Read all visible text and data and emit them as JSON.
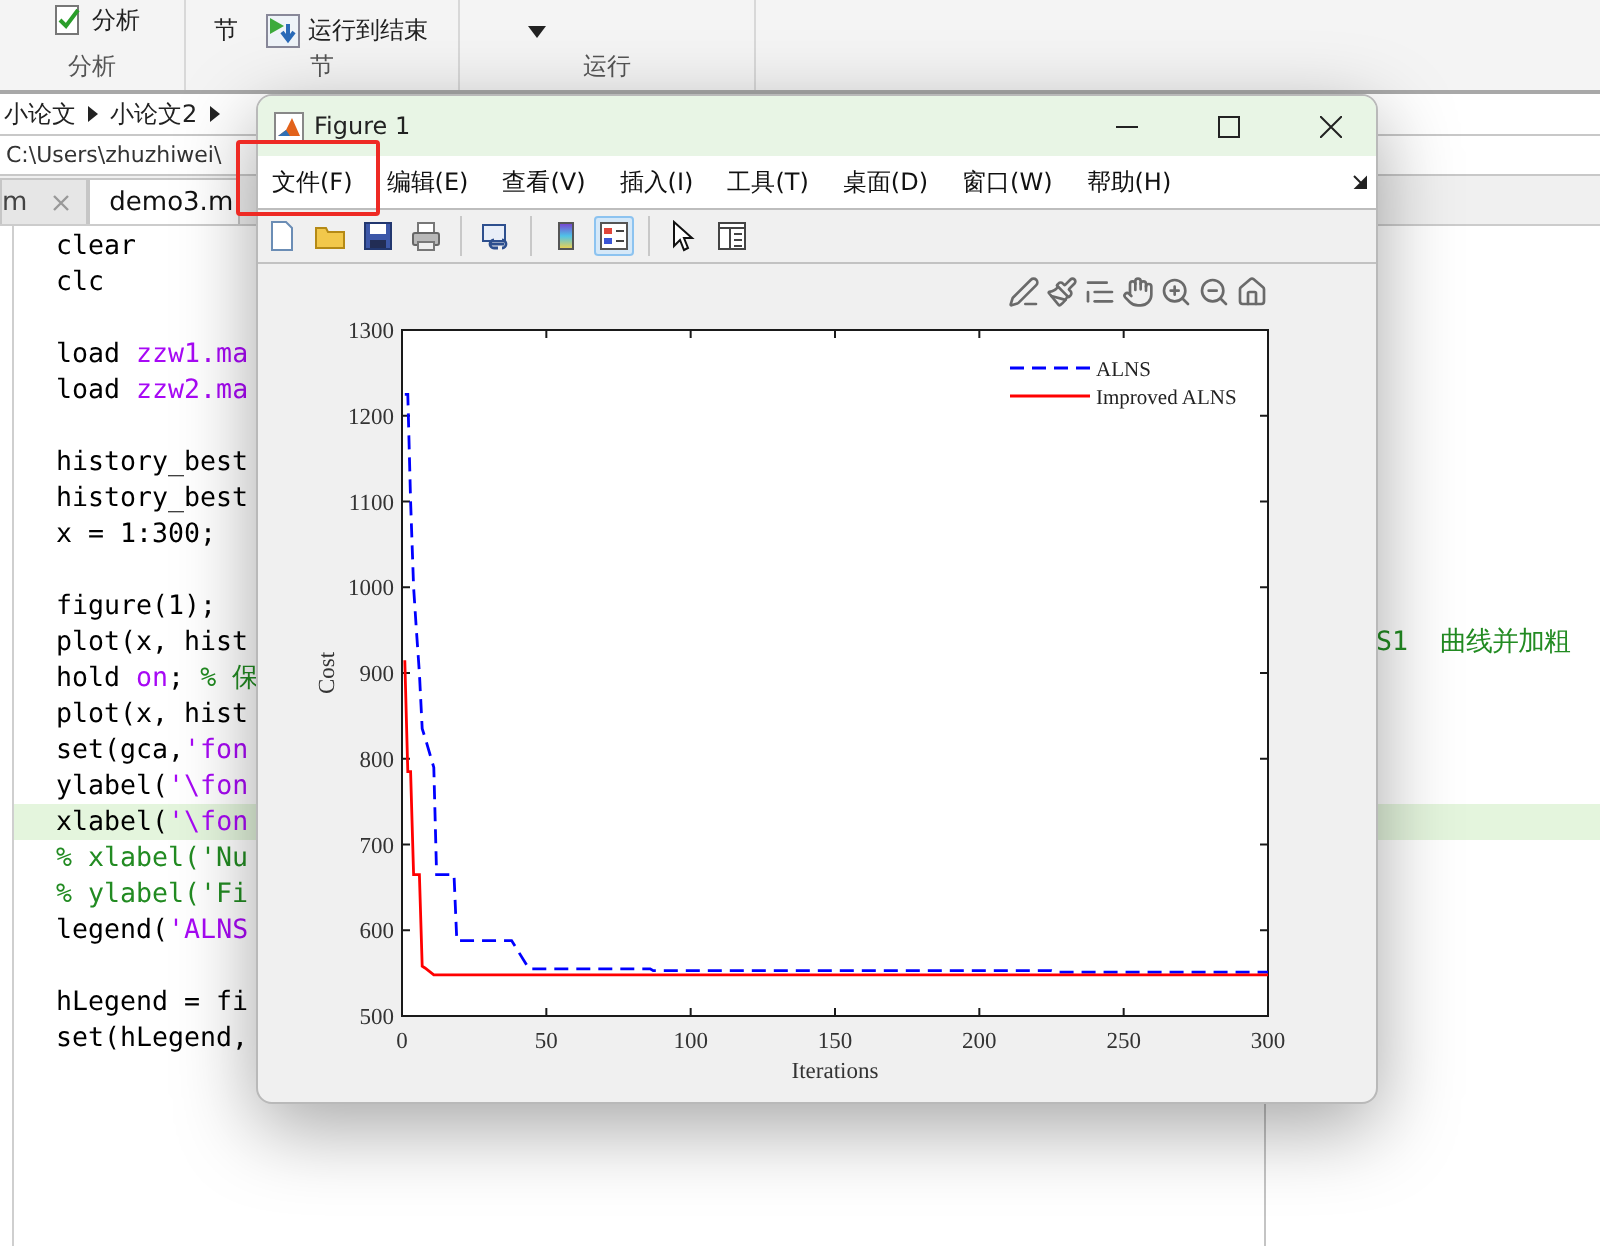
{
  "toolstrip": {
    "sections": [
      {
        "label": "分析",
        "buttons": [
          {
            "kind": "analyze",
            "label": "分析"
          }
        ]
      },
      {
        "label": "节",
        "buttons": [
          {
            "kind": "run-section",
            "label": "节"
          },
          {
            "kind": "run-to-end",
            "label": "运行到结束"
          }
        ]
      },
      {
        "label": "运行",
        "buttons": [
          {
            "kind": "run-menu"
          }
        ]
      }
    ]
  },
  "breadcrumb": [
    "小论文",
    "小论文2"
  ],
  "path": "C:\\Users\\zhuzhiwei\\",
  "editor_tabs": [
    {
      "label": "m",
      "selected": false
    },
    {
      "label": "demo3.m",
      "selected": true
    }
  ],
  "code_lines": [
    {
      "segments": [
        {
          "text": "clear",
          "kind": "plain"
        }
      ],
      "highlighted": false
    },
    {
      "segments": [
        {
          "text": "clc",
          "kind": "plain"
        }
      ],
      "highlighted": false
    },
    {
      "highlighted": false
    },
    {
      "segments": [
        {
          "text": "load ",
          "kind": "plain"
        },
        {
          "text": "zzw1.ma",
          "kind": "string"
        }
      ],
      "highlighted": false
    },
    {
      "segments": [
        {
          "text": "load ",
          "kind": "plain"
        },
        {
          "text": "zzw2.ma",
          "kind": "string"
        }
      ],
      "highlighted": false
    },
    {
      "highlighted": false
    },
    {
      "segments": [
        {
          "text": "history_best",
          "kind": "plain"
        }
      ],
      "highlighted": false
    },
    {
      "segments": [
        {
          "text": "history_best",
          "kind": "plain"
        }
      ],
      "highlighted": false
    },
    {
      "segments": [
        {
          "text": "x = 1:300;",
          "kind": "plain"
        }
      ],
      "highlighted": false
    },
    {
      "highlighted": false
    },
    {
      "segments": [
        {
          "text": "figure(1);",
          "kind": "plain"
        }
      ],
      "highlighted": false
    },
    {
      "segments": [
        {
          "text": "plot(x, hist",
          "kind": "plain"
        }
      ],
      "tail": "S1  曲线并加粗",
      "highlighted": false
    },
    {
      "segments": [
        {
          "text": "hold ",
          "kind": "plain"
        },
        {
          "text": "on",
          "kind": "string"
        },
        {
          "text": "; ",
          "kind": "plain"
        },
        {
          "text": "% 保",
          "kind": "comment"
        }
      ],
      "highlighted": false
    },
    {
      "segments": [
        {
          "text": "plot(x, hist",
          "kind": "plain"
        }
      ],
      "highlighted": false
    },
    {
      "segments": [
        {
          "text": "set(gca,",
          "kind": "plain"
        },
        {
          "text": "'fon",
          "kind": "string"
        }
      ],
      "highlighted": false
    },
    {
      "segments": [
        {
          "text": "ylabel(",
          "kind": "plain"
        },
        {
          "text": "'\\fon",
          "kind": "string"
        }
      ],
      "highlighted": false
    },
    {
      "segments": [
        {
          "text": "xlabel(",
          "kind": "plain"
        },
        {
          "text": "'\\fon",
          "kind": "string"
        }
      ],
      "highlighted": true
    },
    {
      "segments": [
        {
          "text": "% xlabel('Nu",
          "kind": "comment"
        }
      ],
      "highlighted": false
    },
    {
      "segments": [
        {
          "text": "% ylabel('Fi",
          "kind": "comment"
        }
      ],
      "highlighted": false
    },
    {
      "segments": [
        {
          "text": "legend(",
          "kind": "plain"
        },
        {
          "text": "'ALNS",
          "kind": "string"
        }
      ],
      "highlighted": false
    },
    {
      "highlighted": false
    },
    {
      "segments": [
        {
          "text": "hLegend = fi",
          "kind": "plain"
        }
      ],
      "highlighted": false
    },
    {
      "segments": [
        {
          "text": "set(hLegend,",
          "kind": "plain"
        }
      ],
      "highlighted": false
    }
  ],
  "figure": {
    "title": "Figure 1",
    "menu": [
      "文件(F)",
      "编辑(E)",
      "查看(V)",
      "插入(I)",
      "工具(T)",
      "桌面(D)",
      "窗口(W)",
      "帮助(H)"
    ],
    "toolbar_groups": [
      [
        {
          "kind": "new",
          "selected": false
        },
        {
          "kind": "open",
          "selected": false
        },
        {
          "kind": "save",
          "selected": false
        },
        {
          "kind": "print",
          "selected": false
        }
      ],
      [
        {
          "kind": "link",
          "selected": false
        }
      ],
      [
        {
          "kind": "colorbar",
          "selected": false
        },
        {
          "kind": "legend",
          "selected": true
        }
      ],
      [
        {
          "kind": "pointer",
          "selected": false
        },
        {
          "kind": "property",
          "selected": false
        }
      ]
    ],
    "chart_data": {
      "type": "line",
      "xlabel": "Iterations",
      "ylabel": "Cost",
      "x": [
        1,
        2,
        3,
        4,
        5,
        6,
        7,
        8,
        11,
        12,
        18,
        19,
        38,
        44,
        86,
        87,
        225,
        227,
        300
      ],
      "series": [
        {
          "name": "ALNS",
          "color": "#0000ff",
          "line_style": "dashed",
          "values": [
            1225,
            1225,
            1100,
            1000,
            950,
            900,
            835,
            825,
            790,
            665,
            665,
            588,
            588,
            555,
            555,
            553,
            553,
            551,
            551
          ]
        },
        {
          "name": "Improved ALNS",
          "color": "#ff0000",
          "line_style": "solid",
          "values": [
            915,
            785,
            785,
            665,
            665,
            665,
            558,
            556,
            548,
            548,
            548,
            548,
            548,
            548,
            548,
            548,
            548,
            548,
            548
          ]
        }
      ],
      "legend": true,
      "xlim": [
        0,
        300
      ],
      "ylim": [
        500,
        1300
      ],
      "xticks": [
        0,
        50,
        100,
        150,
        200,
        250,
        300
      ],
      "yticks": [
        500,
        600,
        700,
        800,
        900,
        1000,
        1100,
        1200,
        1300
      ]
    }
  }
}
